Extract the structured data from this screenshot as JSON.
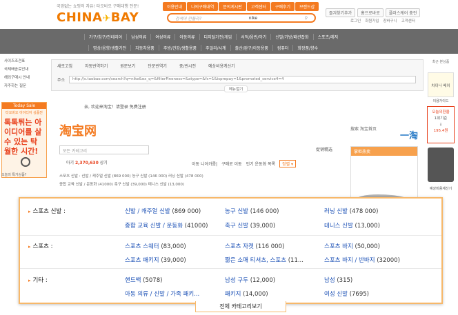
{
  "header": {
    "tagline": "국경없는 쇼핑의 자유! 타오바오 구매대행 전문!",
    "logo_left": "CHINA",
    "logo_plane": "✈",
    "logo_right": "BAY",
    "top_nav": [
      "이용안내",
      "나의구매내역",
      "문의게시판",
      "고객센터",
      "구매후기",
      "브랜드샵"
    ],
    "search_placeholder": "검색어 만들라?",
    "search_query": "nike",
    "util_buttons": [
      "즐겨찾기추가",
      "홈으로바로",
      "플러스케어 충전"
    ],
    "util_links": [
      "로그인",
      "회원가입",
      "장바구니",
      "고객센터"
    ]
  },
  "category_nav": {
    "row1": [
      "가구/침구/인테리어",
      "남성의류",
      "여성의류",
      "아동의류",
      "디지털가전/게임",
      "서적/음반/악기",
      "신발/가방/패션잡화",
      "스포츠/레저"
    ],
    "row2": [
      "명상/음향/생활가전",
      "자동차용품",
      "주방/건강/생활용품",
      "주얼리/시계",
      "출산/완구/아동용품",
      "컴퓨터",
      "화장품/향수"
    ]
  },
  "left_sidebar": {
    "items": [
      "사이즈조견표",
      "국제배송료안내",
      "해외구매시 안내",
      "자주하는 질문"
    ],
    "today_header": "Today Sale",
    "today_sub": "타오바오 아이디어 상품전",
    "today_big": "톡톡튀는 아이디어를 살수 있는 탁월한 시간!",
    "today_question": "오늘의 특가상품?"
  },
  "tabs": [
    "새로고침",
    "자동번역하기",
    "원문보기",
    "단문번역기",
    "중/번시전",
    "예상비용계산기"
  ],
  "url_label": "주소",
  "url_value": "http://s.taobao.com/search?q=nike&ex_q=&filterFineness=&atype=&fs=1&isprepay=1&promoted_service4=4",
  "menu_open": "메뉴열기",
  "welcome": "亲, 欢迎来淘宝！请登录  免费注册",
  "taobao_logo": "淘宝网",
  "right_links": "搜索  淘宝首页",
  "taobao_r": "一淘",
  "cat_search_placeholder": "모든 카테고리",
  "promo_tag": "促销精选",
  "count_label": "아기",
  "count_value": "2,370,630",
  "count_unit": "상기",
  "sort_options": [
    "이동 니아카름|",
    "구매로 이동",
    "인기 운동화 목록"
  ],
  "sort_select": "정렬 ▾",
  "right_box_header": "掌柜热卖",
  "sample_rows": [
    "스포츠 신발 :   신발 / 캐주얼 신발 (869 000)   농구 신발 (146 000)   러닝 신발 (478 000)",
    "                 종합 교육 신발 / 운동화 (41000)   축구 신발 (39,000)   테니스 신발 (13,000)"
  ],
  "right_sidebar": {
    "top": "최근 본상품",
    "badge_text": "차이나 베이",
    "guide": "이용가이드",
    "rate_title": "오늘의환율",
    "rate_unit": "1위기준",
    "rate_value": "195.4원",
    "calc_label": "예상비용계산기"
  },
  "overlay": {
    "rows": [
      {
        "label": "스포츠 신발 :",
        "items": [
          {
            "name": "신발 / 캐주얼 신발",
            "count": "(869 000)"
          },
          {
            "name": "농구 신발",
            "count": "(146 000)"
          },
          {
            "name": "러닝 신발",
            "count": "(478 000)"
          },
          {
            "name": "종합 교육 신발 / 운동화",
            "count": "(41000)"
          },
          {
            "name": "축구 신발",
            "count": "(39,000)"
          },
          {
            "name": "테니스 신발",
            "count": "(13,000)"
          }
        ]
      },
      {
        "label": "스포츠 :",
        "items": [
          {
            "name": "스포츠 스웨터",
            "count": "(83,000)"
          },
          {
            "name": "스포츠 자켓",
            "count": "(116 000)"
          },
          {
            "name": "스포츠 바지",
            "count": "(50,000)"
          },
          {
            "name": "스포츠 패키지",
            "count": "(39,000)"
          },
          {
            "name": "짧은 소매 티셔츠, 스포츠",
            "count": "(11..."
          },
          {
            "name": "스포츠 바지 / 반바지",
            "count": "(32000)"
          }
        ]
      },
      {
        "label": "기타 :",
        "items": [
          {
            "name": "핸드백",
            "count": "(5078)"
          },
          {
            "name": "남성 구두",
            "count": "(12,000)"
          },
          {
            "name": "남성",
            "count": "(315)"
          },
          {
            "name": "아동 의류 / 신발 / 가족 패키...",
            "count": ""
          },
          {
            "name": "패키지",
            "count": "(14,000)"
          },
          {
            "name": "여성 신발",
            "count": "(7695)"
          }
        ]
      }
    ],
    "footer": "전체 카테고리보기"
  },
  "colors": {
    "accent": "#f47a20",
    "nav_bg": "#6a6a6a",
    "link": "#1a4fb5",
    "overlay_border": "#f7b86a"
  }
}
